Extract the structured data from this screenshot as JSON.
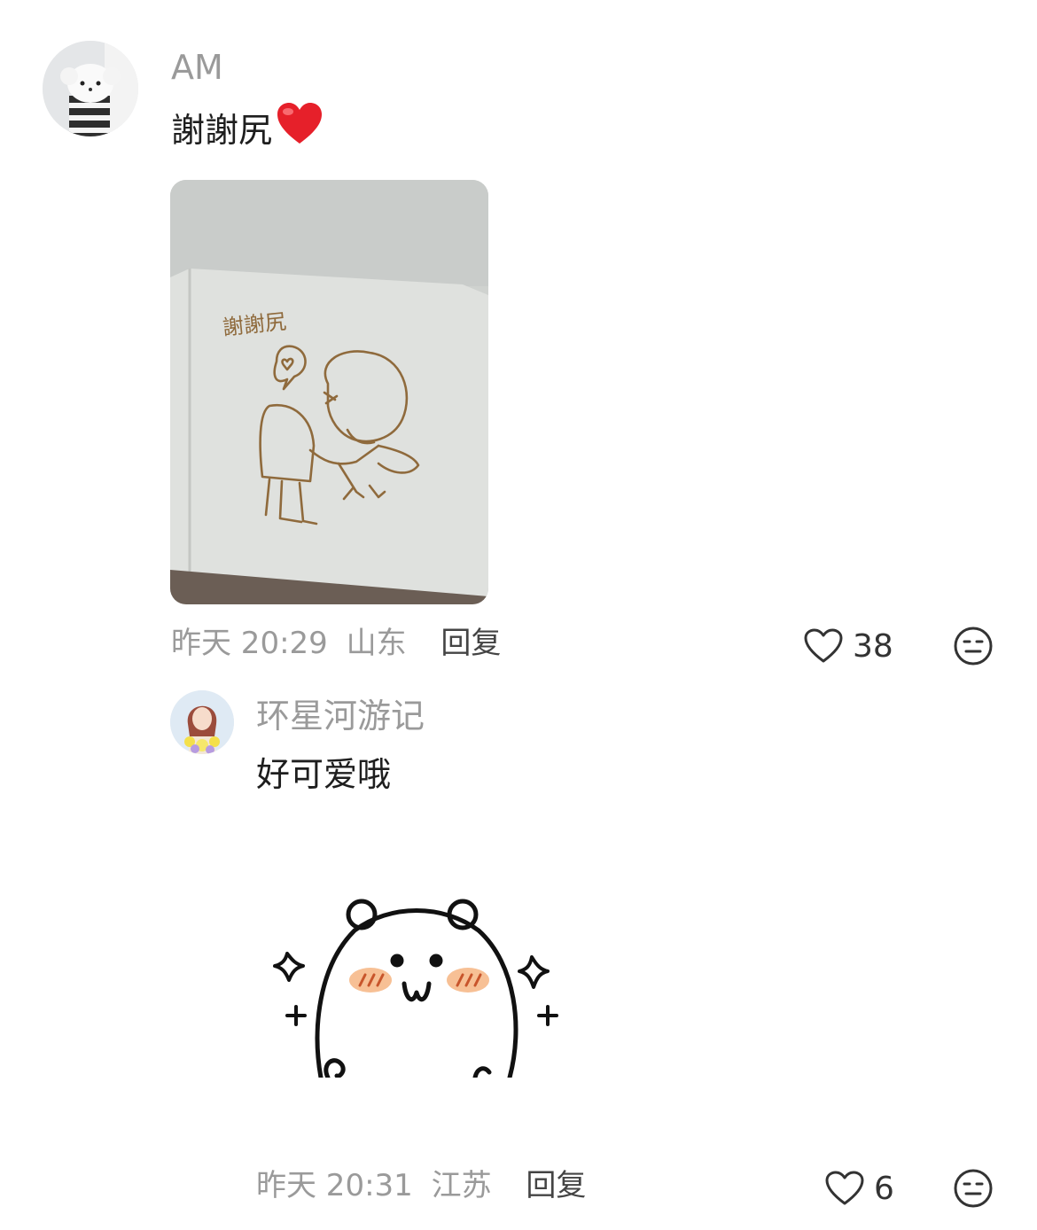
{
  "comments": [
    {
      "username": "AM",
      "text": "謝謝尻",
      "emoji": "red-heart-icon",
      "image": "photo-handdrawn-card",
      "image_text": "謝謝尻",
      "time": "昨天 20:29",
      "location": "山东",
      "reply_label": "回复",
      "likes": "38"
    }
  ],
  "replies": [
    {
      "username": "环星河游记",
      "text": "好可爱哦",
      "sticker": "bear-sticker",
      "time": "昨天 20:31",
      "location": "江苏",
      "reply_label": "回复",
      "likes": "6"
    }
  ],
  "colors": {
    "meta_text": "#9a9a9a",
    "content_text": "#1e1e1e",
    "heart_red": "#e6202a"
  }
}
